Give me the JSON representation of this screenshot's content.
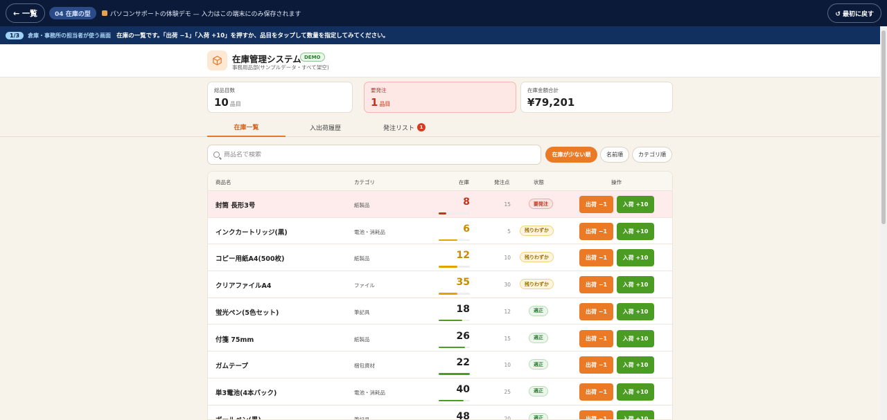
{
  "topbar": {
    "back_label": "← 一覧",
    "chapter_label": "04 在庫の型",
    "notice": "パソコンサポートの体験デモ — 入力はこの端末にのみ保存されます",
    "reset_label": "↺ 最初に戻す"
  },
  "stepbar": {
    "step": "1/3",
    "role": "倉庫・事務所の担当者が使う画面",
    "text": "在庫の一覧です。「出荷 −1」「入荷 +10」を押すか、品目をタップして数量を指定してみてください。"
  },
  "header": {
    "title": "在庫管理システム",
    "badge": "DEMO",
    "subtitle": "事務用品部(サンプルデータ・すべて架空)"
  },
  "summary": {
    "items_label": "総品目数",
    "items_value": "10",
    "items_unit": "品目",
    "reorder_label": "要発注",
    "reorder_value": "1",
    "reorder_unit": "品目",
    "value_label": "在庫金額合計",
    "value_value": "¥79,201"
  },
  "tabs": {
    "inventory": "在庫一覧",
    "history": "入出荷履歴",
    "orders": "発注リスト",
    "orders_badge": "1"
  },
  "search": {
    "placeholder": "商品名で検索"
  },
  "sort": {
    "low_stock": "在庫が少ない順",
    "name": "名前順",
    "category": "カテゴリ順"
  },
  "table": {
    "headers": {
      "name": "商品名",
      "category": "カテゴリ",
      "stock": "在庫",
      "reorder": "発注点",
      "status": "状態",
      "actions": "操作"
    },
    "out_label": "出荷 −1",
    "in_label": "入荷 +10",
    "rows": [
      {
        "name": "封筒 長形3号",
        "category": "紙製品",
        "stock": "8",
        "reorder": "15",
        "status": "要発注",
        "level": "urgent",
        "fill": 0.25,
        "color": "#c6321b"
      },
      {
        "name": "インクカートリッジ(黒)",
        "category": "電池・消耗品",
        "stock": "6",
        "reorder": "5",
        "status": "残りわずか",
        "level": "low",
        "fill": 0.6,
        "color": "#c88a00"
      },
      {
        "name": "コピー用紙A4(500枚)",
        "category": "紙製品",
        "stock": "12",
        "reorder": "10",
        "status": "残りわずか",
        "level": "low",
        "fill": 0.6,
        "color": "#c88a00"
      },
      {
        "name": "クリアファイルA4",
        "category": "ファイル",
        "stock": "35",
        "reorder": "30",
        "status": "残りわずか",
        "level": "low",
        "fill": 0.6,
        "color": "#c88a00"
      },
      {
        "name": "蛍光ペン(5色セット)",
        "category": "筆記具",
        "stock": "18",
        "reorder": "12",
        "status": "適正",
        "level": "ok",
        "fill": 0.75,
        "color": "#1f1f1f"
      },
      {
        "name": "付箋 75mm",
        "category": "紙製品",
        "stock": "26",
        "reorder": "15",
        "status": "適正",
        "level": "ok",
        "fill": 0.85,
        "color": "#1f1f1f"
      },
      {
        "name": "ガムテープ",
        "category": "梱包資材",
        "stock": "22",
        "reorder": "10",
        "status": "適正",
        "level": "ok",
        "fill": 1.0,
        "color": "#1f1f1f"
      },
      {
        "name": "単3電池(4本パック)",
        "category": "電池・消耗品",
        "stock": "40",
        "reorder": "25",
        "status": "適正",
        "level": "ok",
        "fill": 0.8,
        "color": "#1f1f1f"
      },
      {
        "name": "ボールペン(黒)",
        "category": "筆記具",
        "stock": "48",
        "reorder": "20",
        "status": "適正",
        "level": "ok",
        "fill": 1.0,
        "color": "#1f1f1f"
      }
    ]
  },
  "colors": {
    "accent": "#ea7a26",
    "success": "#4a9c22",
    "danger": "#c6321b",
    "navy": "#0b1a38"
  }
}
